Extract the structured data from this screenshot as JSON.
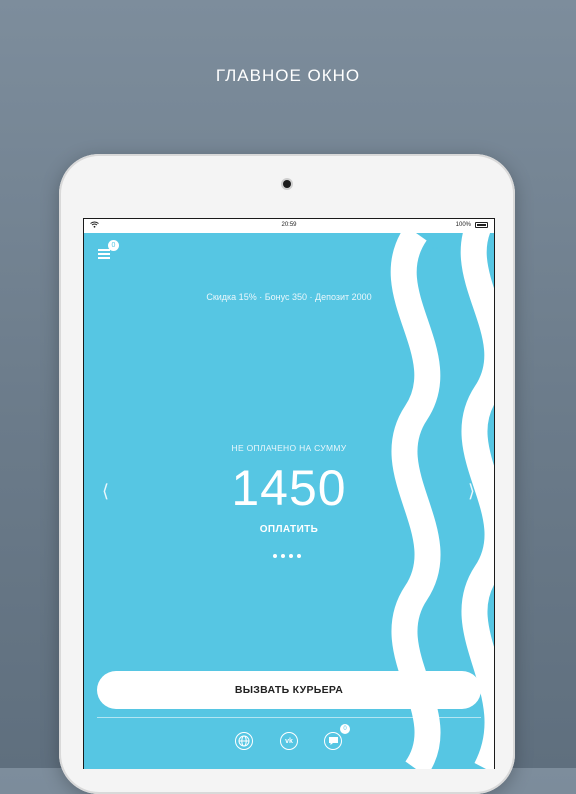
{
  "caption": "ГЛАВНОЕ ОКНО",
  "statusbar": {
    "time": "20:59",
    "battery": "100%"
  },
  "menu": {
    "badge": "0"
  },
  "summary_text": "Скидка 15% · Бонус 350 · Депозит 2000",
  "payment": {
    "status_label": "НЕ ОПЛАЧЕНО НА СУММУ",
    "amount": "1450",
    "pay_label": "ОПЛАТИТЬ"
  },
  "pager": {
    "pages": 4
  },
  "courier_button": {
    "label": "ВЫЗВАТЬ КУРЬЕРА"
  },
  "bottom_bar": {
    "vk_label": "vk",
    "chat_badge": "0"
  },
  "colors": {
    "screen_bg": "#56c6e3",
    "wave": "#ffffff"
  },
  "icons": [
    "wifi-icon",
    "battery-icon",
    "menu-icon",
    "calendar-icon",
    "globe-icon",
    "vk-icon",
    "chat-icon"
  ]
}
